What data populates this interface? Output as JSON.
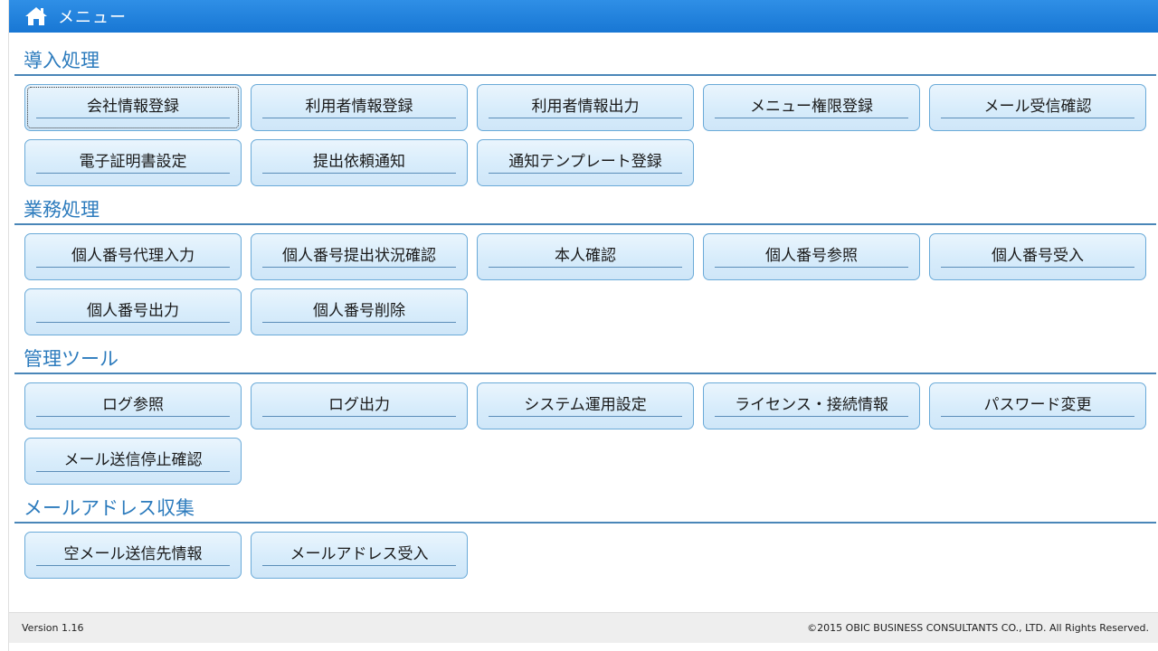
{
  "header": {
    "title": "メニュー",
    "icon": "home-icon"
  },
  "sections": [
    {
      "title": "導入処理",
      "buttons": [
        "会社情報登録",
        "利用者情報登録",
        "利用者情報出力",
        "メニュー権限登録",
        "メール受信確認",
        "電子証明書設定",
        "提出依頼通知",
        "通知テンプレート登録"
      ]
    },
    {
      "title": "業務処理",
      "buttons": [
        "個人番号代理入力",
        "個人番号提出状況確認",
        "本人確認",
        "個人番号参照",
        "個人番号受入",
        "個人番号出力",
        "個人番号削除"
      ]
    },
    {
      "title": "管理ツール",
      "buttons": [
        "ログ参照",
        "ログ出力",
        "システム運用設定",
        "ライセンス・接続情報",
        "パスワード変更",
        "メール送信停止確認"
      ]
    },
    {
      "title": "メールアドレス収集",
      "buttons": [
        "空メール送信先情報",
        "メールアドレス受入"
      ]
    }
  ],
  "footer": {
    "version": "Version 1.16",
    "copyright": "©2015 OBIC BUSINESS CONSULTANTS CO., LTD. All Rights Reserved."
  },
  "colors": {
    "header_bg": "#1f80da",
    "section_title": "#2c7bbd",
    "button_border": "#6aaad8",
    "button_bg": "#d7ecfb"
  }
}
